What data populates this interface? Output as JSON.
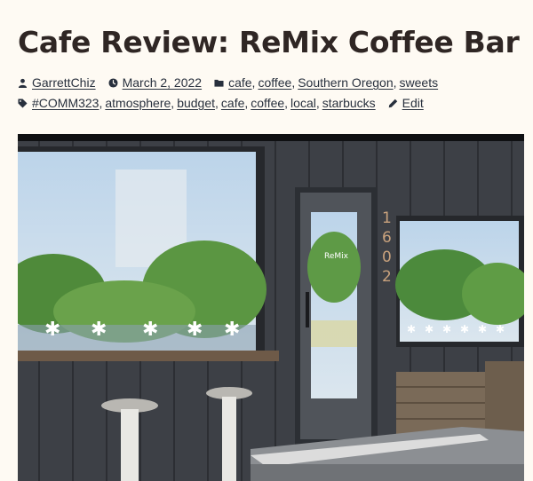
{
  "post": {
    "title": "Cafe Review: ReMix Coffee Bar",
    "author": "GarrettChiz",
    "date": "March 2, 2022",
    "categories": [
      "cafe",
      "coffee",
      "Southern Oregon",
      "sweets"
    ],
    "tags": [
      "#COMM323",
      "atmosphere",
      "budget",
      "cafe",
      "coffee",
      "local",
      "starbucks"
    ],
    "edit_label": "Edit"
  },
  "image": {
    "address_number": "1602",
    "door_sign": "ReMix"
  },
  "icons": {
    "author": "person-icon",
    "date": "clock-icon",
    "categories": "folder-icon",
    "tags": "tag-icon",
    "edit": "pencil-icon"
  }
}
